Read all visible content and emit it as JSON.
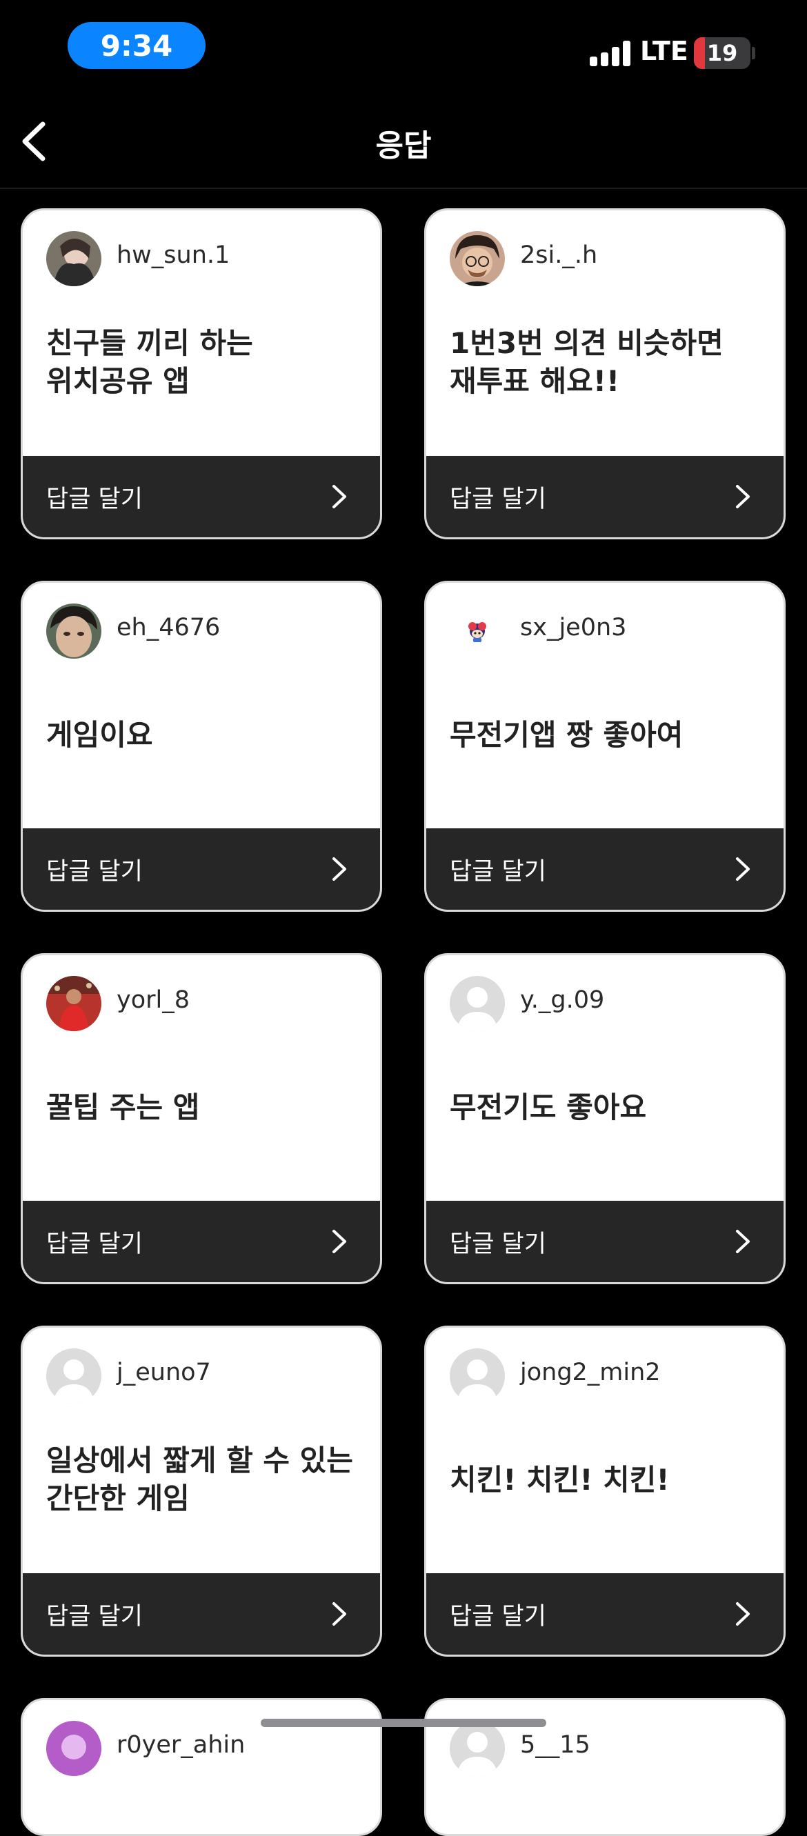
{
  "status_bar": {
    "time": "9:34",
    "network": "LTE",
    "battery": "19"
  },
  "nav": {
    "title": "응답"
  },
  "reply_label": "답글 달기",
  "cards": [
    {
      "username": "hw_sun.1",
      "answer": "친구들 끼리 하는\n위치공유 앱",
      "avatar": "photo"
    },
    {
      "username": "2si._.h",
      "answer": "1번3번 의견 비슷하면\n재투표 해요!!",
      "avatar": "photo"
    },
    {
      "username": "eh_4676",
      "answer": "게임이요",
      "avatar": "photo"
    },
    {
      "username": "sx_je0n3",
      "answer": "무전기앱 짱 좋아여",
      "avatar": "sticker"
    },
    {
      "username": "yorl_8",
      "answer": "꿀팁 주는 앱",
      "avatar": "photo"
    },
    {
      "username": "y._g.09",
      "answer": "무전기도 좋아요",
      "avatar": "default"
    },
    {
      "username": "j_euno7",
      "answer": "일상에서 짧게 할 수 있는\n간단한 게임",
      "avatar": "default"
    },
    {
      "username": "jong2_min2",
      "answer": "치킨! 치킨! 치킨!",
      "avatar": "default"
    },
    {
      "username": "r0yer_ahin",
      "answer": "",
      "avatar": "photo"
    },
    {
      "username": "5__15",
      "answer": "",
      "avatar": "default"
    }
  ],
  "colors": {
    "accent": "#0a84ff",
    "card_bg": "#ffffff",
    "reply_bar": "#262626",
    "background": "#000000"
  }
}
